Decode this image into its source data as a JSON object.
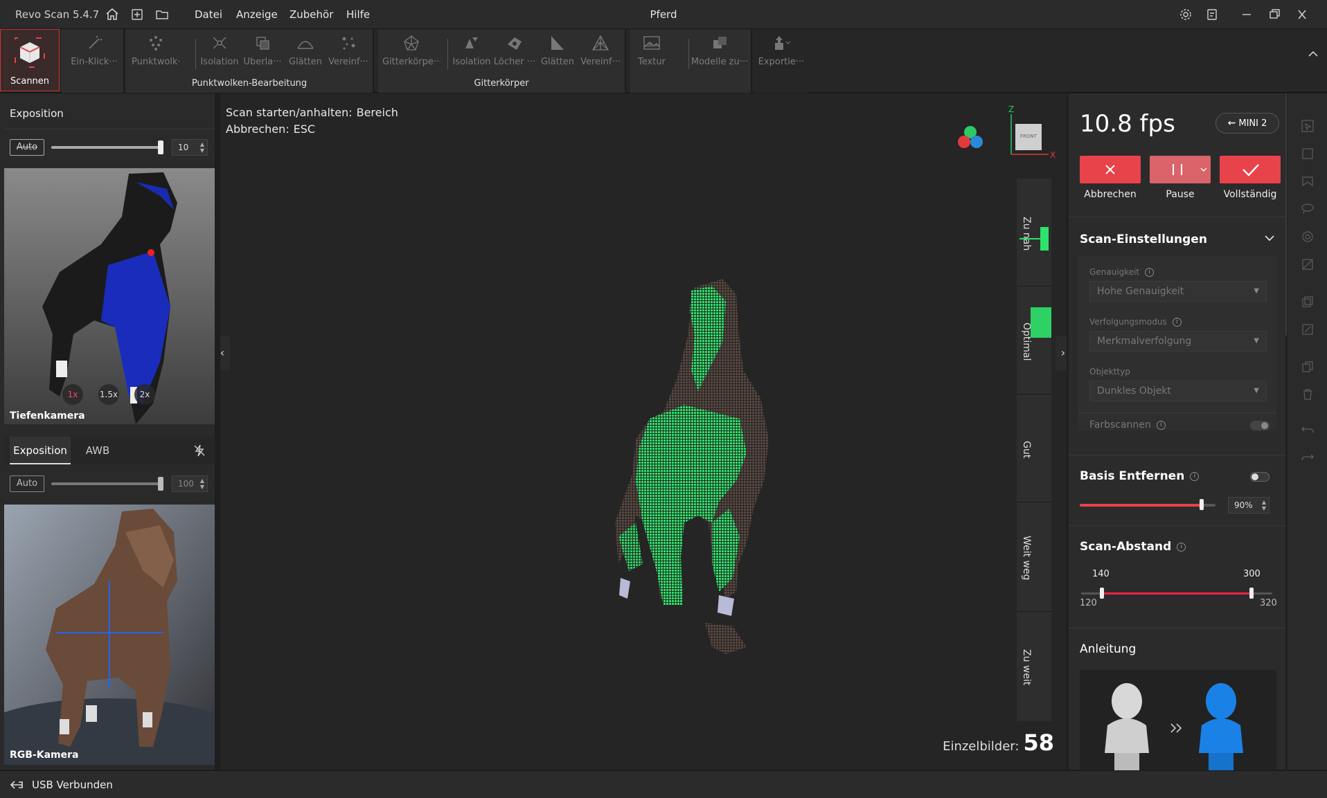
{
  "app": {
    "name": "Revo Scan 5.4.7",
    "document_title": "Pferd"
  },
  "menu": [
    "Datei",
    "Anzeige",
    "Zubehör",
    "Hilfe"
  ],
  "toolbar": {
    "scan_label": "Scannen",
    "one_click_label": "Ein-Klick···",
    "pointcloud_group": {
      "label": "Punktwolken-Bearbeitung",
      "tools": [
        "Punktwolk···",
        "Isolation",
        "Überla···",
        "Glätten",
        "Vereinf···"
      ]
    },
    "mesh_group": {
      "label": "Gitterkörper",
      "tools": [
        "Gitterkörpe···",
        "Isolation",
        "Löcher ···",
        "Glätten",
        "Vereinf···"
      ]
    },
    "texture_label": "Textur",
    "models_label": "Modelle zu···",
    "export_label": "Exportie···"
  },
  "left_panel": {
    "depth": {
      "exposure_label": "Exposition",
      "auto_label": "Auto",
      "exposure_value": "10",
      "exposure_fraction": 1.0,
      "zoom_options": [
        "1x",
        "1.5x",
        "2x"
      ],
      "zoom_active": "1x",
      "camera_label": "Tiefenkamera"
    },
    "rgb": {
      "tabs": [
        "Exposition",
        "AWB"
      ],
      "auto_label": "Auto",
      "exposure_value": "100",
      "exposure_fraction": 1.0,
      "camera_label": "RGB-Kamera"
    }
  },
  "viewport": {
    "hint_start_label": "Scan starten/anhalten:",
    "hint_start_value": "Bereich",
    "hint_cancel_label": "Abbrechen:",
    "hint_cancel_value": "ESC",
    "gizmo_front": "FRONT",
    "axis_z": "Z",
    "axis_x": "X",
    "distance_labels": [
      "Zu nah",
      "Optimal",
      "Gut",
      "Weit weg",
      "Zu weit"
    ],
    "frames_label": "Einzelbilder:",
    "frames_value": "58"
  },
  "right_panel": {
    "fps": "10.8 fps",
    "device": "MINI 2",
    "buttons": [
      "Abbrechen",
      "Pause",
      "Vollständig"
    ],
    "scan_settings": {
      "title": "Scan-Einstellungen",
      "accuracy_label": "Genauigkeit",
      "accuracy_value": "Hohe Genauigkeit",
      "tracking_label": "Verfolgungsmodus",
      "tracking_value": "Merkmalverfolgung",
      "object_label": "Objekttyp",
      "object_value": "Dunkles Objekt",
      "color_scan_label": "Farbscannen"
    },
    "remove_base": {
      "title": "Basis Entfernen",
      "value": "90%",
      "fraction": 0.9
    },
    "scan_distance": {
      "title": "Scan-Abstand",
      "low": "140",
      "high": "300",
      "min": "120",
      "max": "320"
    },
    "guide_title": "Anleitung"
  },
  "status": {
    "text": "USB Verbunden"
  },
  "colors": {
    "accent": "#e8424a",
    "point_green": "#2ee36a"
  }
}
